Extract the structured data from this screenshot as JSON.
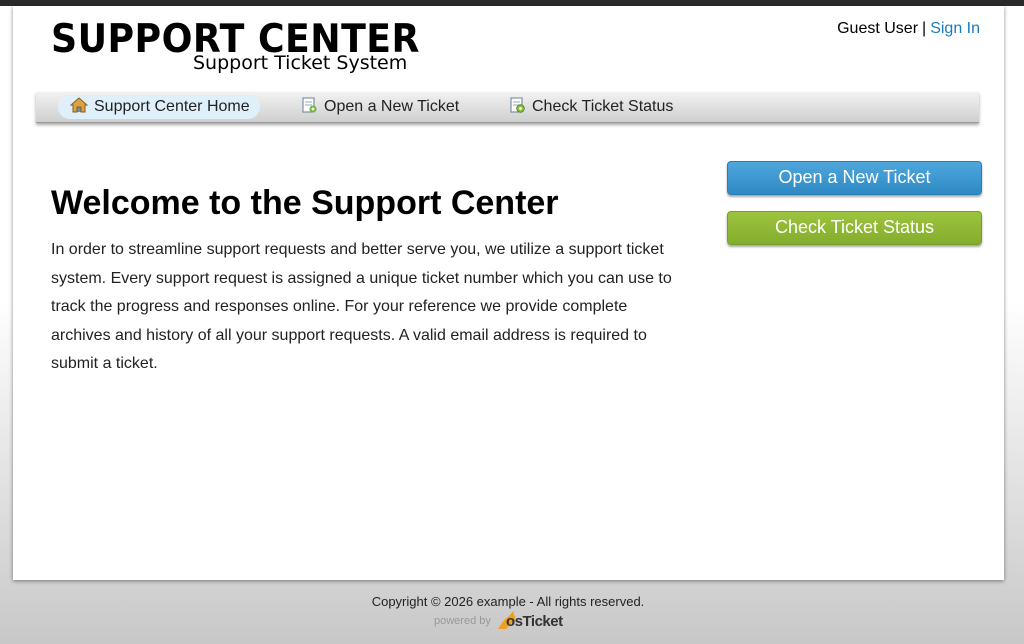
{
  "header": {
    "title": "SUPPORT CENTER",
    "subtitle": "Support Ticket System",
    "user": "Guest User",
    "separator": "|",
    "sign_in": "Sign In"
  },
  "nav": [
    {
      "label": "Support Center Home",
      "icon": "home-icon",
      "active": true
    },
    {
      "label": "Open a New Ticket",
      "icon": "new-ticket-icon",
      "active": false
    },
    {
      "label": "Check Ticket Status",
      "icon": "ticket-status-icon",
      "active": false
    }
  ],
  "main": {
    "heading": "Welcome to the Support Center",
    "intro": "In order to streamline support requests and better serve you, we utilize a support ticket system. Every support request is assigned a unique ticket number which you can use to track the progress and responses online. For your reference we provide complete archives and history of all your support requests. A valid email address is required to submit a ticket."
  },
  "sidebar": {
    "open_ticket_label": "Open a New Ticket",
    "check_status_label": "Check Ticket Status"
  },
  "footer": {
    "copyright": "Copyright © 2026 example - All rights reserved.",
    "powered_by": "powered by",
    "brand": "osTicket"
  },
  "colors": {
    "link": "#1a7ab9",
    "blue_button": "#3a96d0",
    "green_button": "#8fb736",
    "active_nav": "#dff0fb"
  }
}
